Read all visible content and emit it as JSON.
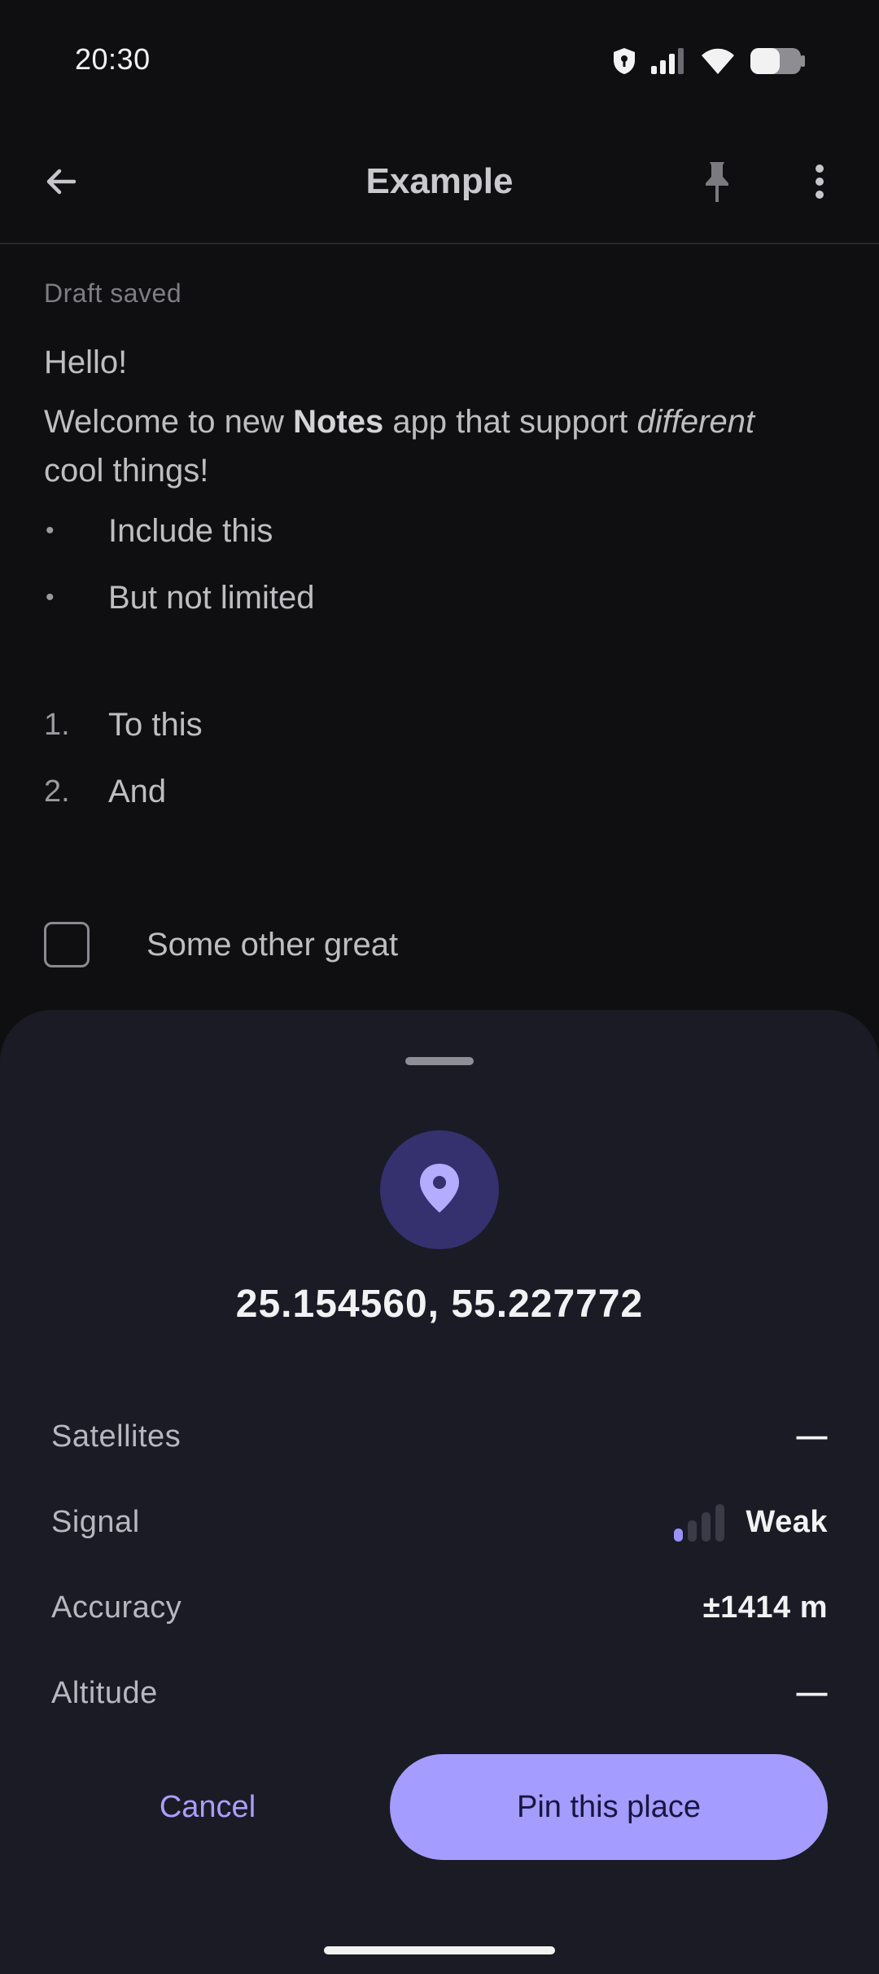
{
  "status_bar": {
    "time": "20:30",
    "icons": [
      "shield-icon",
      "cell-signal-icon",
      "wifi-icon",
      "battery-icon"
    ]
  },
  "app_bar": {
    "title": "Example",
    "icons": [
      "back-arrow-icon",
      "pin-icon",
      "more-vert-icon"
    ]
  },
  "note": {
    "status": "Draft saved",
    "greeting": "Hello!",
    "welcome": {
      "part1": "Welcome to new ",
      "bold": "Notes",
      "part2": " app that support ",
      "italic": "different",
      "part3": "cool things!"
    },
    "bullets": [
      "Include this",
      "But not limited"
    ],
    "numbered": [
      {
        "marker": "1.",
        "text": "To this"
      },
      {
        "marker": "2.",
        "text": "And"
      }
    ],
    "checklist": [
      {
        "checked": false,
        "text": "Some other great"
      }
    ]
  },
  "location_sheet": {
    "icon": "location-pin-icon",
    "coordinates": "25.154560, 55.227772",
    "rows": [
      {
        "label": "Satellites",
        "value": "—"
      },
      {
        "label": "Signal",
        "value": "Weak",
        "signal_level_of_4": 1
      },
      {
        "label": "Accuracy",
        "value": "±1414 m"
      },
      {
        "label": "Altitude",
        "value": "—"
      }
    ],
    "cancel_label": "Cancel",
    "confirm_label": "Pin this place"
  },
  "colors": {
    "background": "#0f0f12",
    "sheet": "#1a1b24",
    "accent": "#a49cff",
    "accent_dark": "#35306e"
  }
}
